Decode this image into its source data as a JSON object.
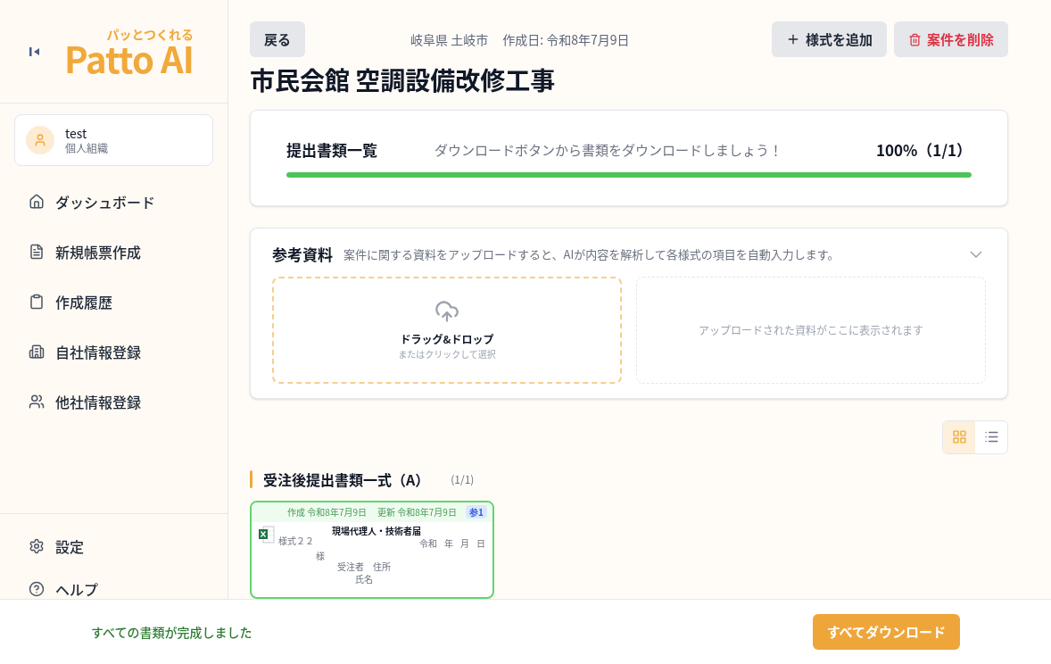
{
  "sidebar": {
    "logo": {
      "tagline": "パッとつくれる",
      "name": "Patto AI"
    },
    "user": {
      "name": "test",
      "org": "個人組織"
    },
    "nav": [
      {
        "label": "ダッシュボード"
      },
      {
        "label": "新規帳票作成"
      },
      {
        "label": "作成履歴"
      },
      {
        "label": "自社情報登録"
      },
      {
        "label": "他社情報登録"
      }
    ],
    "bottom_nav": [
      {
        "label": "設定"
      },
      {
        "label": "ヘルプ"
      }
    ]
  },
  "header": {
    "back": "戻る",
    "location": "岐阜県 土岐市",
    "created": "作成日: 令和8年7月9日",
    "add_button": "様式を追加",
    "delete_button": "案件を削除"
  },
  "title": "市民会館 空調設備改修工事",
  "progress": {
    "title": "提出書類一覧",
    "message": "ダウンロードボタンから書類をダウンロードしましょう！",
    "reading": "100%（1/1）",
    "level": 1
  },
  "references": {
    "title": "参考資料",
    "description": "案件に関する資料をアップロードすると、AIが内容を解析して各様式の項目を自動入力します。",
    "expanded": true,
    "drop_title": "ドラッグ&ドロップ",
    "drop_hint": "またはクリックして選択",
    "empty": "アップロードされた資料がここに表示されます"
  },
  "view_toggle": [
    {
      "kind": "grid",
      "selected": true
    },
    {
      "kind": "list",
      "selected": false
    }
  ],
  "group": {
    "title": "受注後提出書類一式（A）",
    "count": "(1/1)",
    "documents": [
      {
        "created": "作成 令和8年7月9日",
        "updated": "更新 令和8年7月9日",
        "badge": "参1",
        "completed": true,
        "preview": {
          "form_no": "様式２２",
          "heading": "現場代理人・技術者届",
          "date": [
            "令和",
            "年",
            "月",
            "日"
          ],
          "addressee": "様",
          "contractor": "受注者　住所",
          "name": "氏名"
        }
      }
    ]
  },
  "footer": {
    "status": "すべての書類が完成しました",
    "download": "すべてダウンロード"
  }
}
